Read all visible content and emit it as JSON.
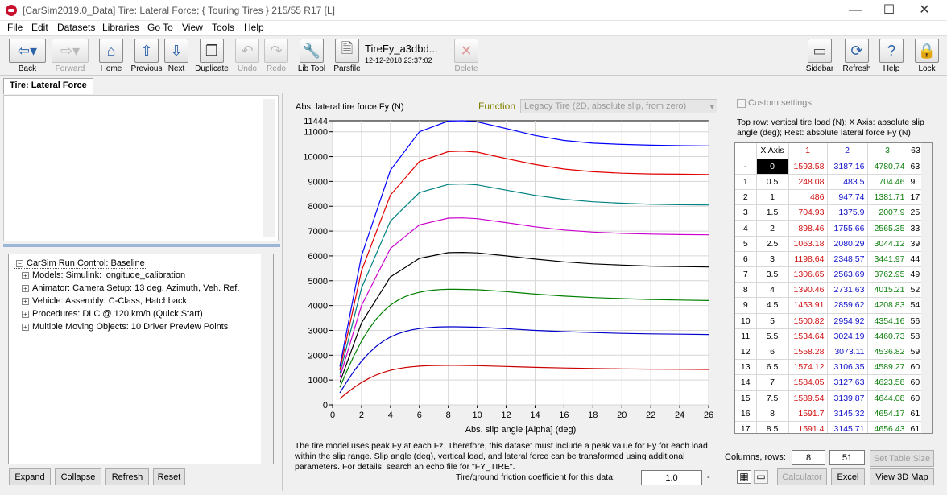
{
  "window": {
    "title": "[CarSim2019.0_Data] Tire: Lateral Force; { Touring Tires } 215/55 R17 [L]",
    "minimize": "—",
    "maximize": "☐",
    "close": "✕"
  },
  "menu": [
    "File",
    "Edit",
    "Datasets",
    "Libraries",
    "Go To",
    "View",
    "Tools",
    "Help"
  ],
  "toolbar": {
    "back": "Back",
    "forward": "Forward",
    "home": "Home",
    "previous": "Previous",
    "next": "Next",
    "duplicate": "Duplicate",
    "undo": "Undo",
    "redo": "Redo",
    "lib_tool": "Lib Tool",
    "parsfile": "Parsfile",
    "parsfile_name": "TireFy_a3dbd...",
    "parsfile_date": "12-12-2018 23:37:02",
    "delete": "Delete",
    "sidebar": "Sidebar",
    "refresh": "Refresh",
    "help": "Help",
    "lock": "Lock"
  },
  "tab": "Tire: Lateral Force",
  "tree": {
    "root": "CarSim Run Control: Baseline",
    "items": [
      "Models: Simulink: longitude_calibration",
      "Animator: Camera Setup: 13 deg. Azimuth, Veh. Ref.",
      "Vehicle: Assembly: C-Class, Hatchback",
      "Procedures: DLC @ 120 km/h (Quick Start)",
      "Multiple Moving Objects: 10 Driver Preview Points"
    ]
  },
  "left_buttons": [
    "Expand",
    "Collapse",
    "Refresh",
    "Reset"
  ],
  "function_label": "Function",
  "function_value": "Legacy Tire (2D, absolute slip, from zero)",
  "chart_data": {
    "type": "line",
    "title": "Abs. lateral tire force Fy (N)",
    "xlabel": "Abs. slip angle [Alpha] (deg)",
    "ylabel": "Abs. lateral tire force Fy (N)",
    "xlim": [
      0,
      26
    ],
    "ylim": [
      0,
      11444
    ],
    "x_ticks": [
      0,
      2,
      4,
      6,
      8,
      10,
      12,
      14,
      16,
      18,
      20,
      22,
      24,
      26
    ],
    "y_ticks": [
      0,
      1000,
      2000,
      3000,
      4000,
      5000,
      6000,
      7000,
      8000,
      9000,
      10000,
      11000,
      11444
    ],
    "grid": true,
    "series": [
      {
        "color": "#cc0000",
        "x": [
          0.5,
          1,
          1.5,
          2,
          2.5,
          3,
          3.5,
          4,
          4.5,
          5,
          5.5,
          6,
          6.5,
          7,
          7.5,
          8,
          8.5,
          10,
          12,
          14,
          16,
          18,
          20,
          22,
          24,
          26
        ],
        "y": [
          248.08,
          486,
          704.93,
          898.46,
          1063.18,
          1198.64,
          1306.65,
          1390.46,
          1453.91,
          1500.82,
          1534.64,
          1558.28,
          1574.12,
          1584.05,
          1589.54,
          1591.7,
          1591.4,
          1580,
          1545,
          1510,
          1485,
          1465,
          1450,
          1440,
          1432,
          1425
        ]
      },
      {
        "color": "#0000cc",
        "x": [
          0.5,
          1,
          1.5,
          2,
          2.5,
          3,
          3.5,
          4,
          4.5,
          5,
          5.5,
          6,
          6.5,
          7,
          7.5,
          8,
          8.5,
          10,
          12,
          14,
          16,
          18,
          20,
          22,
          24,
          26
        ],
        "y": [
          483.5,
          947.74,
          1375.9,
          1755.66,
          2080.29,
          2348.57,
          2563.69,
          2731.63,
          2859.62,
          2954.92,
          3024.19,
          3073.11,
          3106.35,
          3127.63,
          3139.87,
          3145.32,
          3145.71,
          3130,
          3070,
          3000,
          2950,
          2910,
          2880,
          2860,
          2845,
          2835
        ]
      },
      {
        "color": "#008000",
        "x": [
          0.5,
          1,
          1.5,
          2,
          2.5,
          3,
          3.5,
          4,
          4.5,
          5,
          5.5,
          6,
          6.5,
          7,
          7.5,
          8,
          8.5,
          10,
          12,
          14,
          16,
          18,
          20,
          22,
          24,
          26
        ],
        "y": [
          704.46,
          1381.71,
          2007.9,
          2565.35,
          3044.12,
          3441.97,
          3762.95,
          4015.21,
          4208.83,
          4354.16,
          4460.73,
          4536.82,
          4589.27,
          4623.58,
          4644.08,
          4654.17,
          4656.43,
          4640,
          4560,
          4460,
          4380,
          4320,
          4280,
          4245,
          4220,
          4200
        ]
      },
      {
        "color": "#000000",
        "x": [
          0.5,
          2,
          4,
          6,
          8,
          9,
          10,
          12,
          14,
          16,
          18,
          20,
          22,
          24,
          26
        ],
        "y": [
          900,
          3300,
          5150,
          5900,
          6130,
          6140,
          6120,
          6000,
          5870,
          5760,
          5680,
          5630,
          5590,
          5570,
          5555
        ]
      },
      {
        "color": "#cc00cc",
        "x": [
          0.5,
          2,
          4,
          6,
          8,
          9,
          10,
          12,
          14,
          16,
          18,
          20,
          22,
          24,
          26
        ],
        "y": [
          1100,
          4000,
          6300,
          7250,
          7520,
          7530,
          7500,
          7340,
          7170,
          7040,
          6960,
          6910,
          6880,
          6860,
          6850
        ]
      },
      {
        "color": "#008080",
        "x": [
          0.5,
          2,
          4,
          6,
          8,
          9,
          10,
          12,
          14,
          16,
          18,
          20,
          22,
          24,
          26
        ],
        "y": [
          1250,
          4700,
          7400,
          8550,
          8880,
          8900,
          8860,
          8650,
          8440,
          8280,
          8180,
          8120,
          8080,
          8060,
          8050
        ]
      },
      {
        "color": "#e00000",
        "x": [
          0.5,
          2,
          4,
          6,
          8,
          9,
          10,
          12,
          14,
          16,
          18,
          20,
          22,
          24,
          26
        ],
        "y": [
          1400,
          5400,
          8450,
          9800,
          10200,
          10220,
          10180,
          9920,
          9680,
          9500,
          9390,
          9330,
          9300,
          9290,
          9280
        ]
      },
      {
        "color": "#0000ff",
        "x": [
          0.5,
          2,
          4,
          6,
          8,
          9,
          10,
          12,
          14,
          16,
          18,
          20,
          22,
          24,
          26
        ],
        "y": [
          1550,
          6000,
          9450,
          11000,
          11430,
          11444,
          11400,
          11130,
          10850,
          10650,
          10540,
          10490,
          10460,
          10440,
          10430
        ]
      }
    ]
  },
  "description": "The tire model uses peak Fy at each Fz. Therefore, this dataset must include a peak value for Fy for each load within the slip range. Slip angle (deg), vertical load, and lateral force can be transformed using additional parameters. For details, search an echo file for \"FY_TIRE\".",
  "friction": {
    "label": "Tire/ground friction coefficient for this data:",
    "value": "1.0",
    "suffix": "-"
  },
  "custom_settings": "Custom settings",
  "table_note": "Top row: vertical tire load (N); X Axis: absolute slip angle (deg); Rest: absolute lateral force Fy (N)",
  "table": {
    "header": [
      "X Axis",
      "1",
      "2",
      "3",
      "63"
    ],
    "rows": [
      [
        "-",
        "0",
        "1593.58",
        "3187.16",
        "4780.74",
        "63"
      ],
      [
        "1",
        "0.5",
        "248.08",
        "483.5",
        "704.46",
        "9"
      ],
      [
        "2",
        "1",
        "486",
        "947.74",
        "1381.71",
        "17"
      ],
      [
        "3",
        "1.5",
        "704.93",
        "1375.9",
        "2007.9",
        "25"
      ],
      [
        "4",
        "2",
        "898.46",
        "1755.66",
        "2565.35",
        "33"
      ],
      [
        "5",
        "2.5",
        "1063.18",
        "2080.29",
        "3044.12",
        "39"
      ],
      [
        "6",
        "3",
        "1198.64",
        "2348.57",
        "3441.97",
        "44"
      ],
      [
        "7",
        "3.5",
        "1306.65",
        "2563.69",
        "3762.95",
        "49"
      ],
      [
        "8",
        "4",
        "1390.46",
        "2731.63",
        "4015.21",
        "52"
      ],
      [
        "9",
        "4.5",
        "1453.91",
        "2859.62",
        "4208.83",
        "54"
      ],
      [
        "10",
        "5",
        "1500.82",
        "2954.92",
        "4354.16",
        "56"
      ],
      [
        "11",
        "5.5",
        "1534.64",
        "3024.19",
        "4460.73",
        "58"
      ],
      [
        "12",
        "6",
        "1558.28",
        "3073.11",
        "4536.82",
        "59"
      ],
      [
        "13",
        "6.5",
        "1574.12",
        "3106.35",
        "4589.27",
        "60"
      ],
      [
        "14",
        "7",
        "1584.05",
        "3127.63",
        "4623.58",
        "60"
      ],
      [
        "15",
        "7.5",
        "1589.54",
        "3139.87",
        "4644.08",
        "60"
      ],
      [
        "16",
        "8",
        "1591.7",
        "3145.32",
        "4654.17",
        "61"
      ],
      [
        "17",
        "8.5",
        "1591.4",
        "3145.71",
        "4656.43",
        "61"
      ]
    ]
  },
  "columns_rows_label": "Columns, rows:",
  "columns": "8",
  "rows": "51",
  "set_table_size": "Set Table Size",
  "calculator": "Calculator",
  "excel": "Excel",
  "view3d": "View 3D Map"
}
